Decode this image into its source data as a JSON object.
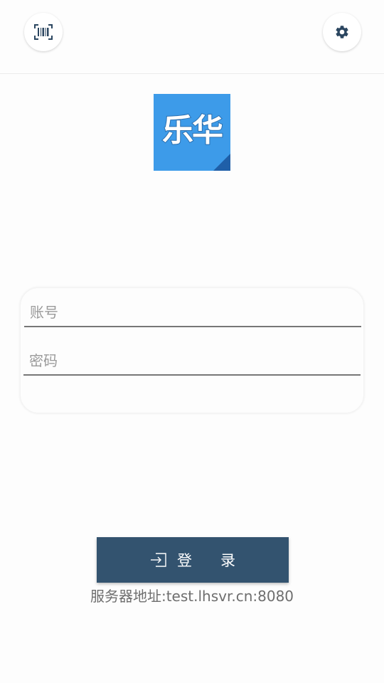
{
  "header": {
    "scan_icon": "barcode-scan-icon",
    "settings_icon": "gear-icon"
  },
  "logo": {
    "text": "乐华",
    "color": "#3d9be9"
  },
  "form": {
    "account_placeholder": "账号",
    "account_value": "",
    "password_placeholder": "密码",
    "password_value": ""
  },
  "login": {
    "label": "登录",
    "icon": "login-arrow-icon",
    "color": "#33536f"
  },
  "server": {
    "text": "服务器地址:test.lhsvr.cn:8080"
  }
}
